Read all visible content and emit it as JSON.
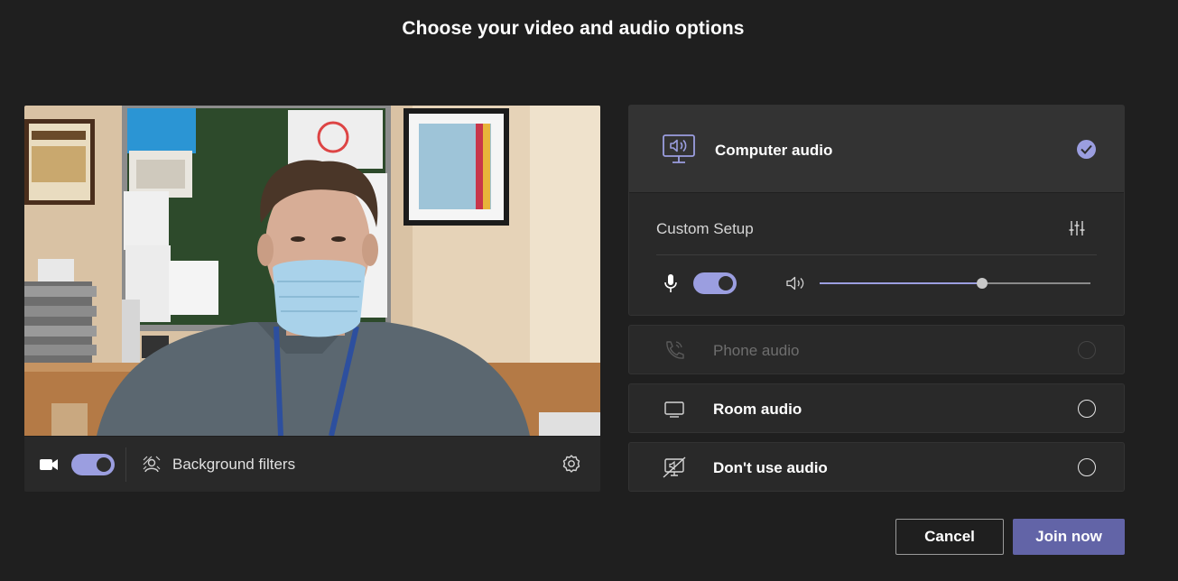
{
  "page": {
    "title": "Choose your video and audio options"
  },
  "video": {
    "camera_on": true,
    "background_filters_label": "Background filters"
  },
  "audio": {
    "options": {
      "computer": {
        "label": "Computer audio",
        "selected": true
      },
      "phone": {
        "label": "Phone audio",
        "selected": false,
        "disabled": true
      },
      "room": {
        "label": "Room audio",
        "selected": false
      },
      "none": {
        "label": "Don't use audio",
        "selected": false
      }
    },
    "custom_setup_label": "Custom Setup",
    "mic_on": true,
    "speaker_volume": 0.6
  },
  "buttons": {
    "cancel": "Cancel",
    "join": "Join now"
  },
  "colors": {
    "background": "#1f1f1f",
    "panel": "#292929",
    "accent": "#9b9ee0",
    "primary_button": "#6264a7"
  }
}
